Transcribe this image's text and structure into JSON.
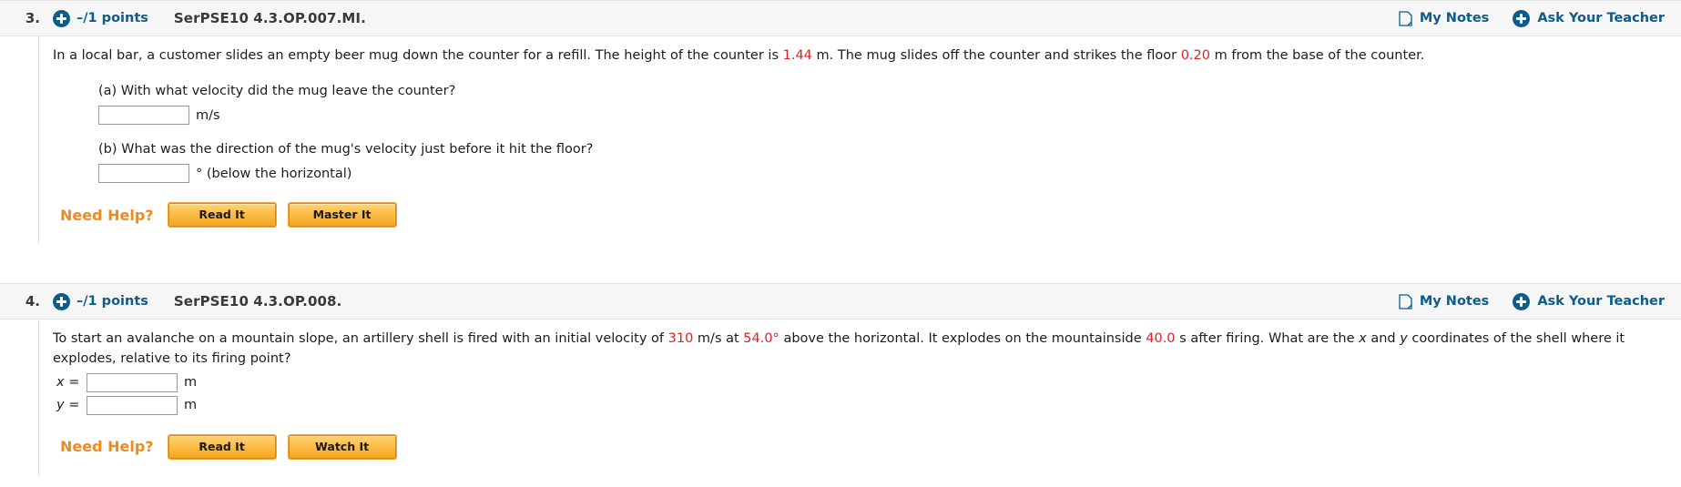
{
  "questions": [
    {
      "number": "3.",
      "points": "–/1 points",
      "code": "SerPSE10 4.3.OP.007.MI.",
      "tools": {
        "notes": "My Notes",
        "ask": "Ask Your Teacher"
      },
      "prompt": {
        "part1": "In a local bar, a customer slides an empty beer mug down the counter for a refill. The height of the counter is ",
        "value1": "1.44",
        "part2": " m. The mug slides off the counter and strikes the floor ",
        "value2": "0.20",
        "part3": " m from the base of the counter."
      },
      "subquestions": [
        {
          "label": "(a) With what velocity did the mug leave the counter?",
          "value": "",
          "unit": "m/s"
        },
        {
          "label": "(b) What was the direction of the mug's velocity just before it hit the floor?",
          "value": "",
          "unit": "° (below the horizontal)"
        }
      ],
      "need_help": {
        "label": "Need Help?",
        "buttons": [
          "Read It",
          "Master It"
        ]
      }
    },
    {
      "number": "4.",
      "points": "–/1 points",
      "code": "SerPSE10 4.3.OP.008.",
      "tools": {
        "notes": "My Notes",
        "ask": "Ask Your Teacher"
      },
      "prompt": {
        "part1": "To start an avalanche on a mountain slope, an artillery shell is fired with an initial velocity of ",
        "value1": "310",
        "part2": " m/s at ",
        "value2": "54.0°",
        "part3": " above the horizontal. It explodes on the mountainside ",
        "value3": "40.0",
        "part4": " s after firing. What are the ",
        "ital1": "x",
        "part5": " and ",
        "ital2": "y",
        "part6": " coordinates of the shell where it explodes, relative to its firing point?"
      },
      "coordinates": [
        {
          "label": "x =",
          "value": "",
          "unit": "m"
        },
        {
          "label": "y =",
          "value": "",
          "unit": "m"
        }
      ],
      "need_help": {
        "label": "Need Help?",
        "buttons": [
          "Read It",
          "Watch It"
        ]
      }
    }
  ],
  "colors": {
    "accent_blue": "#0e5c8a",
    "highlight_red": "#e02020",
    "help_orange": "#f08a1e"
  }
}
